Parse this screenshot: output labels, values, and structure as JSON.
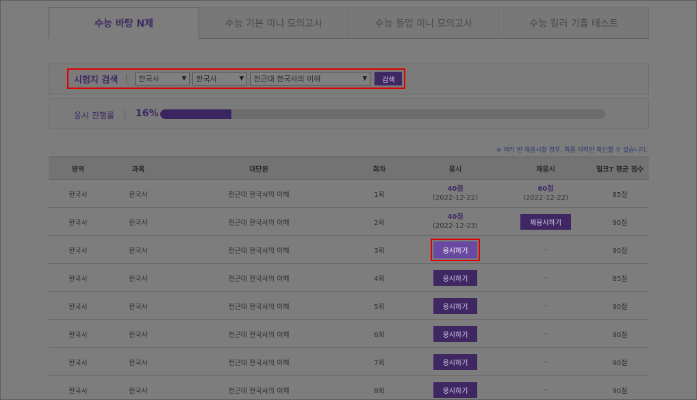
{
  "tabs": [
    "수능 바탕 N제",
    "수능 기본 미니 모의고사",
    "수능 등업 미니 모의고사",
    "수능 킬러 기출 테스트"
  ],
  "search": {
    "title": "시험지 검색",
    "select1": "한국사",
    "select2": "한국사",
    "select3": "전근대 한국사의 이해",
    "button": "검색"
  },
  "progress": {
    "label": "응시 진행률",
    "percent_text": "16%",
    "value": 0.16
  },
  "note": "※ 여러 번 재응시할 경우, 최종 이력만 확인할 수 있습니다.",
  "table": {
    "headers": [
      "영역",
      "과목",
      "대단원",
      "회차",
      "응시",
      "재응시",
      "밀크T 평균 점수"
    ],
    "rows": [
      {
        "area": "한국사",
        "subject": "한국사",
        "unit": "전근대 한국사의 이해",
        "round": "1회",
        "take_score": "40점",
        "take_date": "(2022-12-22)",
        "retake_score": "60점",
        "retake_date": "(2022-12-22)",
        "avg": "85점"
      },
      {
        "area": "한국사",
        "subject": "한국사",
        "unit": "전근대 한국사의 이해",
        "round": "2회",
        "take_score": "40점",
        "take_date": "(2022-12-23)",
        "retake_btn": "재응시하기",
        "avg": "90점"
      },
      {
        "area": "한국사",
        "subject": "한국사",
        "unit": "전근대 한국사의 이해",
        "round": "3회",
        "take_btn": "응시하기",
        "retake": "-",
        "avg": "90점"
      },
      {
        "area": "한국사",
        "subject": "한국사",
        "unit": "전근대 한국사의 이해",
        "round": "4회",
        "take_btn": "응시하기",
        "retake": "-",
        "avg": "85점"
      },
      {
        "area": "한국사",
        "subject": "한국사",
        "unit": "전근대 한국사의 이해",
        "round": "5회",
        "take_btn": "응시하기",
        "retake": "-",
        "avg": "90점"
      },
      {
        "area": "한국사",
        "subject": "한국사",
        "unit": "전근대 한국사의 이해",
        "round": "6회",
        "take_btn": "응시하기",
        "retake": "-",
        "avg": "90점"
      },
      {
        "area": "한국사",
        "subject": "한국사",
        "unit": "전근대 한국사의 이해",
        "round": "7회",
        "take_btn": "응시하기",
        "retake": "-",
        "avg": "90점"
      },
      {
        "area": "한국사",
        "subject": "한국사",
        "unit": "전근대 한국사의 이해",
        "round": "8회",
        "take_btn": "응시하기",
        "retake": "-",
        "avg": "90점"
      }
    ]
  }
}
